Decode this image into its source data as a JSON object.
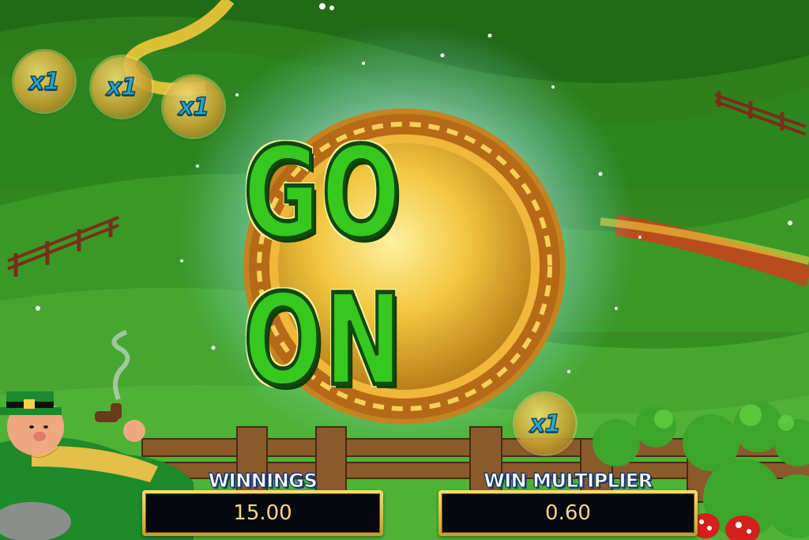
{
  "game": {
    "banner": "GO ON",
    "multiplier_badges": [
      "x1",
      "x1",
      "x1",
      "x1"
    ],
    "winnings": {
      "label": "WINNINGS",
      "value": "15.00"
    },
    "win_multiplier": {
      "label": "WIN MULTIPLIER",
      "value": "0.60"
    }
  },
  "colors": {
    "grass": "#3fa02a",
    "coin_gold": "#e4b02c",
    "text_green": "#37c81f",
    "badge_text": "#2aa8e0",
    "panel_text": "#f4d58c"
  },
  "icons": [
    "leprechaun-character",
    "pipe-smoke",
    "mushroom-icon",
    "fence",
    "sparkle-burst"
  ]
}
